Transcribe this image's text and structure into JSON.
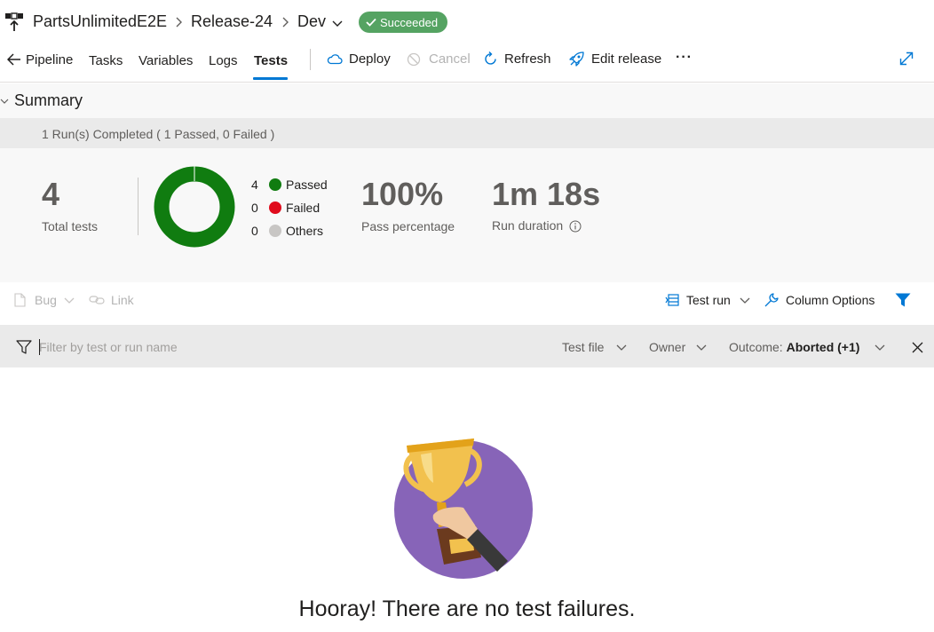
{
  "header": {
    "project": "PartsUnlimitedE2E",
    "release": "Release-24",
    "stage": "Dev",
    "status": "Succeeded"
  },
  "tabs": [
    {
      "label": "Pipeline"
    },
    {
      "label": "Tasks"
    },
    {
      "label": "Variables"
    },
    {
      "label": "Logs"
    },
    {
      "label": "Tests"
    }
  ],
  "toolbar": {
    "deploy": "Deploy",
    "cancel": "Cancel",
    "refresh": "Refresh",
    "edit_release": "Edit release",
    "more": "···"
  },
  "summary": {
    "title": "Summary",
    "runs_text": "1 Run(s) Completed ( 1 Passed, 0 Failed )",
    "total_tests": "4",
    "total_tests_label": "Total tests",
    "legend": [
      {
        "count": "4",
        "label": "Passed",
        "color": "#107c10"
      },
      {
        "count": "0",
        "label": "Failed",
        "color": "#e00b1c"
      },
      {
        "count": "0",
        "label": "Others",
        "color": "#c8c6c4"
      }
    ],
    "pass_percentage": "100%",
    "pass_percentage_label": "Pass percentage",
    "run_duration": "1m 18s",
    "run_duration_label": "Run duration"
  },
  "actions": {
    "bug": "Bug",
    "link": "Link",
    "test_run": "Test run",
    "column_options": "Column Options"
  },
  "filter": {
    "placeholder": "Filter by test or run name",
    "test_file": "Test file",
    "owner": "Owner",
    "outcome_label": "Outcome: ",
    "outcome_value": "Aborted (+1)"
  },
  "empty_state": {
    "message": "Hooray! There are no test failures."
  },
  "colors": {
    "accent": "#0078d4",
    "success_badge": "#55a362",
    "passed": "#107c10"
  }
}
